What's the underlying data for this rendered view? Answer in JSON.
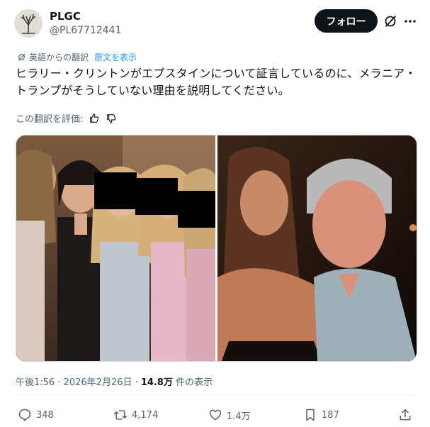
{
  "author": {
    "display_name": "PLGC",
    "handle": "@PL67712441",
    "avatar_icon": "tree-avatar"
  },
  "header": {
    "follow_label": "フォロー",
    "grok_icon": "grok-icon",
    "more_icon": "more-icon"
  },
  "translation": {
    "label": "英語からの翻訳",
    "show_original": "原文を表示"
  },
  "tweet": {
    "text": "ヒラリー・クリントンがエプスタインについて証言しているのに、メラニア・トランプがそうしていない理由を説明してください。"
  },
  "rate": {
    "label": "この翻訳を評価:"
  },
  "meta": {
    "time": "午後1:56 · 2026年2月26日 · ",
    "views": "14.8万",
    "views_suffix": " 件の表示"
  },
  "actions": {
    "replies": "348",
    "reposts": "4,174",
    "likes": "1.4万",
    "bookmarks": "187"
  },
  "colors": {
    "accent": "#1d9bf0",
    "text": "#0f1419",
    "muted": "#536471"
  }
}
